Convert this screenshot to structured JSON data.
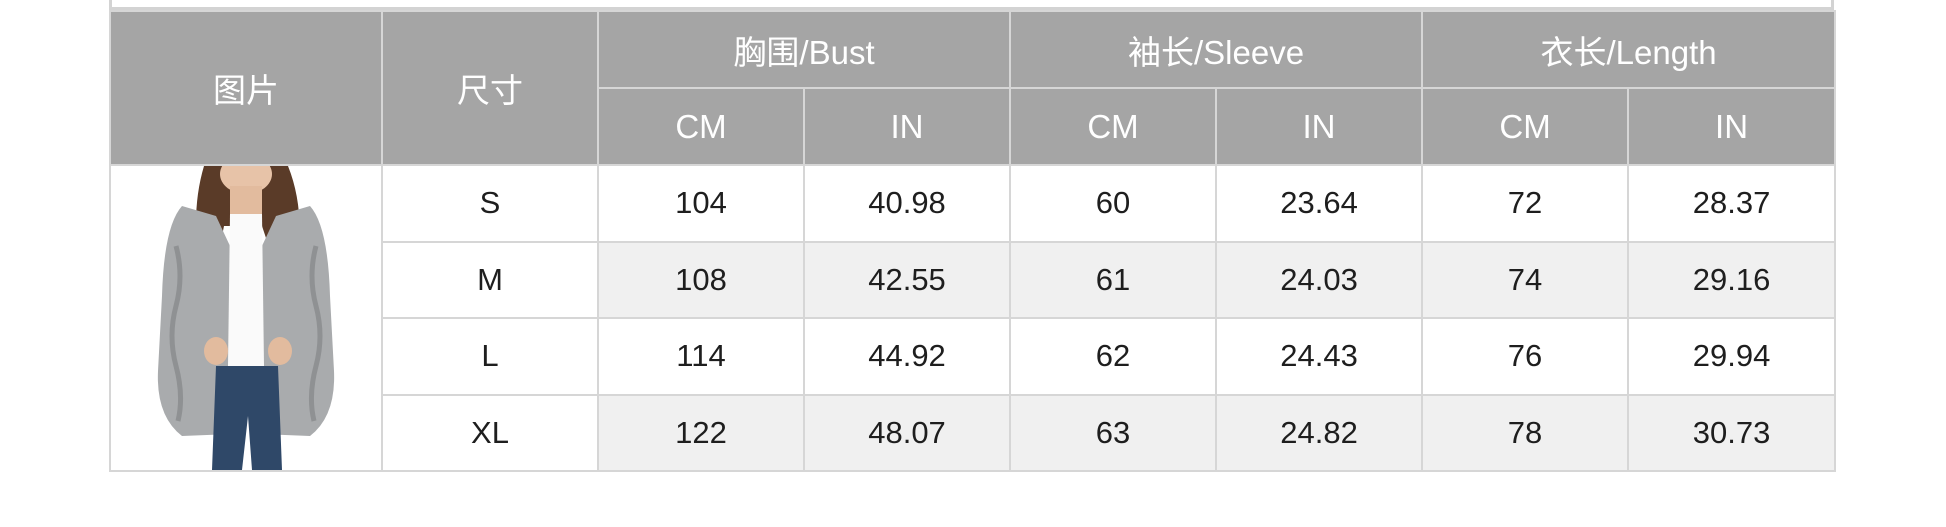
{
  "header": {
    "picture": "图片",
    "size": "尺寸",
    "groups": [
      "胸围/Bust",
      "袖长/Sleeve",
      "衣长/Length"
    ],
    "units": [
      "CM",
      "IN",
      "CM",
      "IN",
      "CM",
      "IN"
    ]
  },
  "rows": [
    {
      "size": "S",
      "values": [
        "104",
        "40.98",
        "60",
        "23.64",
        "72",
        "28.37"
      ]
    },
    {
      "size": "M",
      "values": [
        "108",
        "42.55",
        "61",
        "24.03",
        "74",
        "29.16"
      ]
    },
    {
      "size": "L",
      "values": [
        "114",
        "44.92",
        "62",
        "24.43",
        "76",
        "29.94"
      ]
    },
    {
      "size": "XL",
      "values": [
        "122",
        "48.07",
        "63",
        "24.82",
        "78",
        "30.73"
      ]
    }
  ],
  "photo": {
    "icon": "model-wearing-gray-cardigan",
    "garment_color": "#a9abad"
  }
}
